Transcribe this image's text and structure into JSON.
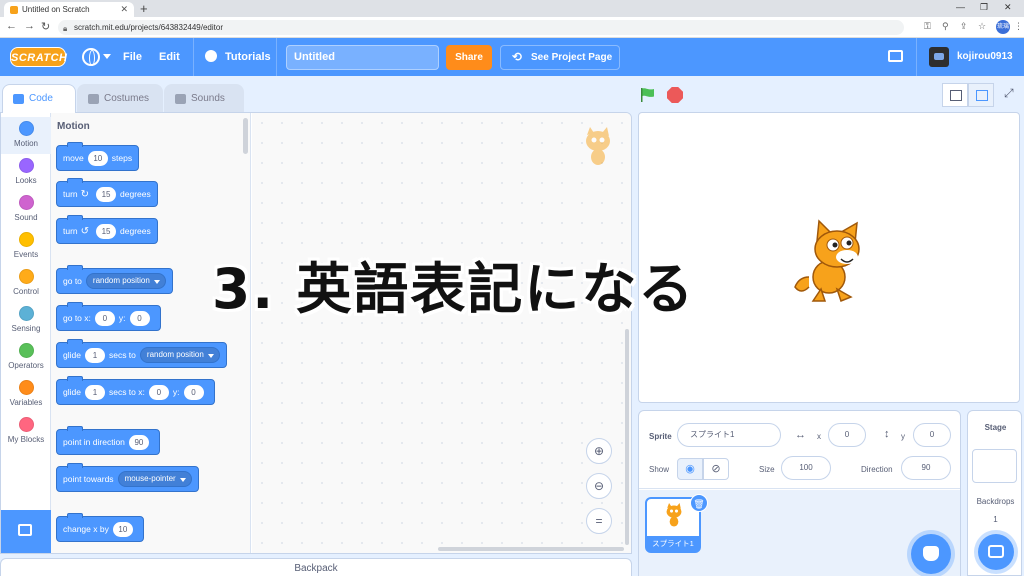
{
  "browser": {
    "tab_title": "Untitled on Scratch",
    "url": "scratch.mit.edu/projects/643832449/editor",
    "profile_initials": "琉璃"
  },
  "menubar": {
    "logo": "SCRATCH",
    "file": "File",
    "edit": "Edit",
    "tutorials": "Tutorials",
    "project_title": "Untitled",
    "share": "Share",
    "see_project_page": "See Project Page",
    "username": "kojirou0913"
  },
  "editor_tabs": [
    "Code",
    "Costumes",
    "Sounds"
  ],
  "categories": [
    {
      "label": "Motion",
      "color": "#4c97ff"
    },
    {
      "label": "Looks",
      "color": "#9966ff"
    },
    {
      "label": "Sound",
      "color": "#cf63cf"
    },
    {
      "label": "Events",
      "color": "#ffbf00"
    },
    {
      "label": "Control",
      "color": "#ffab19"
    },
    {
      "label": "Sensing",
      "color": "#5cb1d6"
    },
    {
      "label": "Operators",
      "color": "#59c059"
    },
    {
      "label": "Variables",
      "color": "#ff8c1a"
    },
    {
      "label": "My Blocks",
      "color": "#ff6680"
    }
  ],
  "palette": {
    "title": "Motion",
    "blocks": {
      "move": {
        "a": "move",
        "n": "10",
        "b": "steps"
      },
      "turn_r": {
        "a": "turn",
        "n": "15",
        "b": "degrees"
      },
      "turn_l": {
        "a": "turn",
        "n": "15",
        "b": "degrees"
      },
      "goto": {
        "a": "go to",
        "dd": "random position"
      },
      "gotoxy": {
        "a": "go to x:",
        "x": "0",
        "b": "y:",
        "y": "0"
      },
      "glide": {
        "a": "glide",
        "n": "1",
        "b": "secs to",
        "dd": "random position"
      },
      "glidexy": {
        "a": "glide",
        "n": "1",
        "b": "secs to x:",
        "x": "0",
        "c": "y:",
        "y": "0"
      },
      "point_dir": {
        "a": "point in direction",
        "n": "90"
      },
      "point_towards": {
        "a": "point towards",
        "dd": "mouse-pointer"
      },
      "change_x": {
        "a": "change x by",
        "n": "10"
      }
    }
  },
  "backpack": "Backpack",
  "sprite_info": {
    "sprite_label": "Sprite",
    "sprite_name": "スプライト1",
    "x_label": "x",
    "x_value": "0",
    "y_label": "y",
    "y_value": "0",
    "show_label": "Show",
    "size_label": "Size",
    "size_value": "100",
    "direction_label": "Direction",
    "direction_value": "90",
    "thumb_name": "スプライト1"
  },
  "stage_pane": {
    "title": "Stage",
    "backdrops_label": "Backdrops",
    "backdrops_count": "1"
  },
  "overlay_caption": "3. 英語表記になる"
}
